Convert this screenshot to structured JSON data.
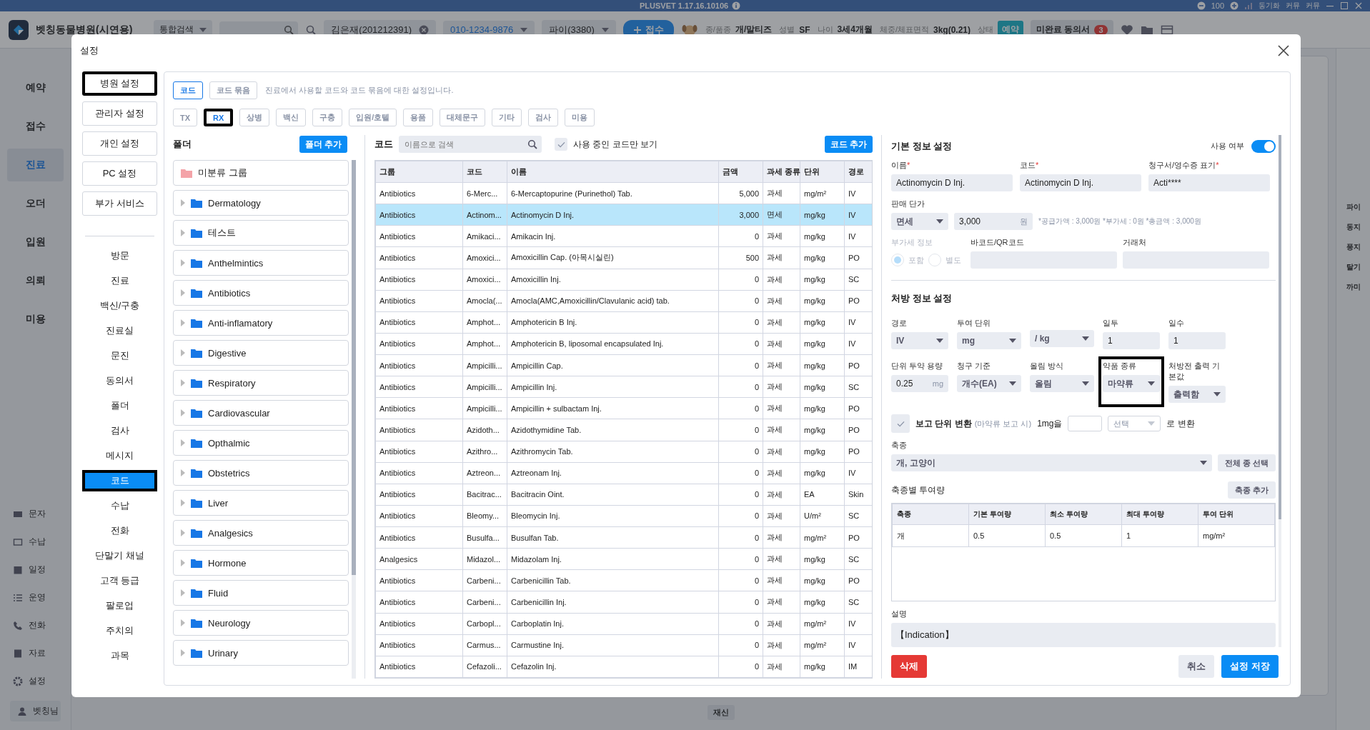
{
  "title_bar": {
    "app": "PLUSVET 1.17.16.10106",
    "zoom": "100",
    "actions": [
      "동기화",
      "커뮤",
      "커뮤"
    ]
  },
  "header": {
    "hospital": "벳칭동물병원(시연용)",
    "search_scope": "통합검색",
    "patient": "김은재(201212391)",
    "phone": "010-1234-9876",
    "pet": "파이(3380)",
    "register": "접수",
    "info": [
      {
        "label": "종/품종",
        "value": "개/말티즈"
      },
      {
        "label": "성별",
        "value": "SF"
      },
      {
        "label": "나이",
        "value": "3세4개월"
      },
      {
        "label": "체중/체표면적",
        "value": "3kg(0.21)"
      },
      {
        "label": "상태",
        "value": "예약"
      }
    ],
    "consent": {
      "label": "미완료 동의서",
      "count": "3"
    }
  },
  "nav": {
    "items": [
      {
        "label": "예약",
        "selected": false
      },
      {
        "label": "접수",
        "selected": false
      },
      {
        "label": "진료",
        "selected": true
      },
      {
        "label": "오더",
        "selected": false
      },
      {
        "label": "입원",
        "selected": false
      },
      {
        "label": "의뢰",
        "selected": false
      },
      {
        "label": "미용",
        "selected": false
      }
    ],
    "bottom": [
      "문자",
      "수납",
      "일정",
      "운영",
      "전화",
      "자료",
      "설정"
    ],
    "user": "벳칭님"
  },
  "side_tabs": [
    "파이",
    "동지",
    "풍지",
    "탈기",
    "까미"
  ],
  "background": {
    "chip": "재신"
  },
  "dialog": {
    "title": "설정",
    "menu_top": [
      {
        "label": "병원 설정",
        "highlighted": true
      },
      {
        "label": "관리자 설정",
        "highlighted": false
      },
      {
        "label": "개인 설정",
        "highlighted": false
      },
      {
        "label": "PC 설정",
        "highlighted": false
      },
      {
        "label": "부가 서비스",
        "highlighted": false
      }
    ],
    "menu": [
      {
        "label": "방문",
        "selected": false,
        "highlighted": false
      },
      {
        "label": "진료",
        "selected": false,
        "highlighted": false
      },
      {
        "label": "백신/구충",
        "selected": false,
        "highlighted": false
      },
      {
        "label": "진료실",
        "selected": false,
        "highlighted": false
      },
      {
        "label": "문진",
        "selected": false,
        "highlighted": false
      },
      {
        "label": "동의서",
        "selected": false,
        "highlighted": false
      },
      {
        "label": "폴더",
        "selected": false,
        "highlighted": false
      },
      {
        "label": "검사",
        "selected": false,
        "highlighted": false
      },
      {
        "label": "메시지",
        "selected": false,
        "highlighted": false
      },
      {
        "label": "코드",
        "selected": true,
        "highlighted": true
      },
      {
        "label": "수납",
        "selected": false,
        "highlighted": false
      },
      {
        "label": "전화",
        "selected": false,
        "highlighted": false
      },
      {
        "label": "단말기 채널",
        "selected": false,
        "highlighted": false
      },
      {
        "label": "고객 등급",
        "selected": false,
        "highlighted": false
      },
      {
        "label": "팔로업",
        "selected": false,
        "highlighted": false
      },
      {
        "label": "주치의",
        "selected": false,
        "highlighted": false
      },
      {
        "label": "과목",
        "selected": false,
        "highlighted": false
      }
    ],
    "mode_tabs": [
      {
        "label": "코드",
        "selected": true
      },
      {
        "label": "코드 묶음",
        "selected": false
      }
    ],
    "description": "진료에서 사용할 코드와 코드 묶음에 대한 설정입니다.",
    "categories": [
      {
        "label": "TX",
        "selected": false,
        "highlighted": false
      },
      {
        "label": "RX",
        "selected": true,
        "highlighted": true
      },
      {
        "label": "상병",
        "selected": false,
        "highlighted": false
      },
      {
        "label": "백신",
        "selected": false,
        "highlighted": false
      },
      {
        "label": "구충",
        "selected": false,
        "highlighted": false
      },
      {
        "label": "입원/호텔",
        "selected": false,
        "highlighted": false
      },
      {
        "label": "용품",
        "selected": false,
        "highlighted": false
      },
      {
        "label": "대체문구",
        "selected": false,
        "highlighted": false
      },
      {
        "label": "기타",
        "selected": false,
        "highlighted": false
      },
      {
        "label": "검사",
        "selected": false,
        "highlighted": false
      },
      {
        "label": "미용",
        "selected": false,
        "highlighted": false
      }
    ],
    "folders": {
      "title": "폴더",
      "add": "폴더 추가",
      "items": [
        {
          "label": "미분류 그룹",
          "kind": "ungrouped"
        },
        {
          "label": "Dermatology",
          "kind": "folder"
        },
        {
          "label": "테스트",
          "kind": "folder"
        },
        {
          "label": "Anthelmintics",
          "kind": "folder"
        },
        {
          "label": "Antibiotics",
          "kind": "folder"
        },
        {
          "label": "Anti-inflamatory",
          "kind": "folder"
        },
        {
          "label": "Digestive",
          "kind": "folder"
        },
        {
          "label": "Respiratory",
          "kind": "folder"
        },
        {
          "label": "Cardiovascular",
          "kind": "folder"
        },
        {
          "label": "Opthalmic",
          "kind": "folder"
        },
        {
          "label": "Obstetrics",
          "kind": "folder"
        },
        {
          "label": "Liver",
          "kind": "folder"
        },
        {
          "label": "Analgesics",
          "kind": "folder"
        },
        {
          "label": "Hormone",
          "kind": "folder"
        },
        {
          "label": "Fluid",
          "kind": "folder"
        },
        {
          "label": "Neurology",
          "kind": "folder"
        },
        {
          "label": "Urinary",
          "kind": "folder"
        }
      ]
    },
    "codes": {
      "title": "코드",
      "search_placeholder": "이름으로 검색",
      "active_only": {
        "label": "사용 중인 코드만 보기",
        "checked": true
      },
      "add": "코드 추가",
      "columns": [
        "그룹",
        "코드",
        "이름",
        "금액",
        "과세 종류",
        "단위",
        "경로"
      ],
      "rows": [
        {
          "selected": false,
          "cells": [
            "Antibiotics",
            "6-Merc...",
            "6-Mercaptopurine (Purinethol) Tab.",
            "5,000",
            "과세",
            "mg/m²",
            "IV"
          ]
        },
        {
          "selected": true,
          "cells": [
            "Antibiotics",
            "Actinom...",
            "Actinomycin D Inj.",
            "3,000",
            "면세",
            "mg/kg",
            "IV"
          ]
        },
        {
          "selected": false,
          "cells": [
            "Antibiotics",
            "Amikaci...",
            "Amikacin Inj.",
            "0",
            "과세",
            "mg/kg",
            "IV"
          ]
        },
        {
          "selected": false,
          "cells": [
            "Antibiotics",
            "Amoxici...",
            "Amoxicillin Cap. (아목시실린)",
            "500",
            "과세",
            "mg/kg",
            "PO"
          ]
        },
        {
          "selected": false,
          "cells": [
            "Antibiotics",
            "Amoxici...",
            "Amoxicillin Inj.",
            "0",
            "과세",
            "mg/kg",
            "SC"
          ]
        },
        {
          "selected": false,
          "cells": [
            "Antibiotics",
            "Amocla(...",
            "Amocla(AMC,Amoxicillin/Clavulanic acid) tab.",
            "0",
            "과세",
            "mg/kg",
            "PO"
          ]
        },
        {
          "selected": false,
          "cells": [
            "Antibiotics",
            "Amphot...",
            "Amphotericin B Inj.",
            "0",
            "과세",
            "mg/kg",
            "IV"
          ]
        },
        {
          "selected": false,
          "cells": [
            "Antibiotics",
            "Amphot...",
            "Amphotericin B, liposomal encapsulated Inj.",
            "0",
            "과세",
            "mg/kg",
            "IV"
          ]
        },
        {
          "selected": false,
          "cells": [
            "Antibiotics",
            "Ampicilli...",
            "Ampicillin Cap.",
            "0",
            "과세",
            "mg/kg",
            "PO"
          ]
        },
        {
          "selected": false,
          "cells": [
            "Antibiotics",
            "Ampicilli...",
            "Ampicillin Inj.",
            "0",
            "과세",
            "mg/kg",
            "SC"
          ]
        },
        {
          "selected": false,
          "cells": [
            "Antibiotics",
            "Ampicilli...",
            "Ampicillin + sulbactam Inj.",
            "0",
            "과세",
            "mg/kg",
            "PO"
          ]
        },
        {
          "selected": false,
          "cells": [
            "Antibiotics",
            "Azidoth...",
            "Azidothymidine Tab.",
            "0",
            "과세",
            "mg/kg",
            "PO"
          ]
        },
        {
          "selected": false,
          "cells": [
            "Antibiotics",
            "Azithro...",
            "Azithromycin Tab.",
            "0",
            "과세",
            "mg/kg",
            "PO"
          ]
        },
        {
          "selected": false,
          "cells": [
            "Antibiotics",
            "Aztreon...",
            "Aztreonam Inj.",
            "0",
            "과세",
            "mg/kg",
            "IV"
          ]
        },
        {
          "selected": false,
          "cells": [
            "Antibiotics",
            "Bacitrac...",
            "Bacitracin Oint.",
            "0",
            "과세",
            "EA",
            "Skin"
          ]
        },
        {
          "selected": false,
          "cells": [
            "Antibiotics",
            "Bleomy...",
            "Bleomycin Inj.",
            "0",
            "과세",
            "U/m²",
            "SC"
          ]
        },
        {
          "selected": false,
          "cells": [
            "Antibiotics",
            "Busulfa...",
            "Busulfan Tab.",
            "0",
            "과세",
            "mg/m²",
            "PO"
          ]
        },
        {
          "selected": false,
          "cells": [
            "Analgesics",
            "Midazol...",
            "Midazolam Inj.",
            "0",
            "과세",
            "mg/kg",
            "SC"
          ]
        },
        {
          "selected": false,
          "cells": [
            "Antibiotics",
            "Carbeni...",
            "Carbenicillin Tab.",
            "0",
            "과세",
            "mg/kg",
            "PO"
          ]
        },
        {
          "selected": false,
          "cells": [
            "Antibiotics",
            "Carbeni...",
            "Carbenicillin Inj.",
            "0",
            "과세",
            "mg/kg",
            "SC"
          ]
        },
        {
          "selected": false,
          "cells": [
            "Antibiotics",
            "Carbopl...",
            "Carboplatin Inj.",
            "0",
            "과세",
            "mg/m²",
            "IV"
          ]
        },
        {
          "selected": false,
          "cells": [
            "Antibiotics",
            "Carmus...",
            "Carmustine Inj.",
            "0",
            "과세",
            "mg/m²",
            "IV"
          ]
        },
        {
          "selected": false,
          "cells": [
            "Antibiotics",
            "Cefazoli...",
            "Cefazolin Inj.",
            "0",
            "과세",
            "mg/kg",
            "IM"
          ]
        }
      ]
    },
    "detail": {
      "basic": {
        "title": "기본 정보 설정",
        "enabled_label": "사용 여부",
        "enabled": true,
        "fields": [
          {
            "label": "이름",
            "mark": "*",
            "value": "Actinomycin D Inj."
          },
          {
            "label": "코드",
            "mark": "*",
            "value": "Actinomycin D Inj."
          },
          {
            "label": "청구서/영수증 표기",
            "mark": "*",
            "value": "Acti****"
          }
        ],
        "price": {
          "label": "판매 단가",
          "tax": "면세",
          "amount": "3,000",
          "unit": "원",
          "summary": "*공급가액 : 3,000원 *부가세 : 0원 *총금액 : 3,000원"
        },
        "vat": {
          "label": "부가세 정보",
          "disabled": true,
          "options": [
            {
              "label": "포함",
              "selected": true
            },
            {
              "label": "별도",
              "selected": false
            }
          ]
        },
        "barcode_label": "바코드/QR코드",
        "vendor_label": "거래처"
      },
      "rx": {
        "title": "처방 정보 설정",
        "fields": [
          {
            "label": "경로",
            "value": "IV",
            "kind": "select",
            "highlighted": false
          },
          {
            "label": "투여 단위",
            "value": "mg",
            "kind": "select",
            "highlighted": false
          },
          {
            "value": "/ kg",
            "kind": "select",
            "highlighted": false
          },
          {
            "label": "일투",
            "value": "1",
            "kind": "input",
            "highlighted": false
          },
          {
            "label": "일수",
            "value": "1",
            "kind": "input",
            "highlighted": false
          },
          {
            "label": "단위 투약 용량",
            "value": "0.25",
            "unit": "mg",
            "kind": "input",
            "highlighted": false
          },
          {
            "label": "청구 기준",
            "value": "개수(EA)",
            "kind": "select",
            "highlighted": false
          },
          {
            "label": "올림 방식",
            "value": "올림",
            "kind": "select",
            "highlighted": false
          },
          {
            "label": "약품 종류",
            "value": "마약류",
            "kind": "select",
            "highlighted": true
          },
          {
            "label": "처방전 출력 기본값",
            "value": "출력함",
            "kind": "select",
            "highlighted": false
          }
        ],
        "conversion": {
          "checked": true,
          "label": "보고 단위 변환",
          "hint": "(마약류 보고 시)",
          "prefix": "1mg을",
          "select_placeholder": "선택",
          "suffix": "로 변환"
        },
        "species": {
          "label": "축종",
          "value": "개, 고양이",
          "all_button": "전체 종 선택"
        },
        "doses": {
          "title": "축종별 투여량",
          "add": "축종 추가",
          "columns": [
            "축종",
            "기본 투여량",
            "최소 투여량",
            "최대 투여량",
            "투여 단위"
          ],
          "rows": [
            [
              "개",
              "0.5",
              "0.5",
              "1",
              "mg/m²"
            ]
          ]
        },
        "description": {
          "label": "설명",
          "value": "【Indication】"
        }
      },
      "footer": {
        "delete": "삭제",
        "cancel": "취소",
        "save": "설정 저장"
      }
    }
  }
}
